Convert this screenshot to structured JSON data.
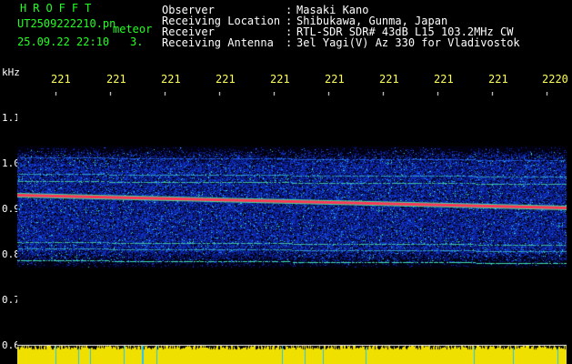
{
  "header": {
    "title": "HROFFT",
    "filename": "UT2509222210.pn",
    "mode": "meteor",
    "datetime": "25.09.22 22:10",
    "count": "3."
  },
  "info": [
    {
      "label": "Observer",
      "value": "Masaki Kano"
    },
    {
      "label": "Receiving Location",
      "value": "Shibukawa, Gunma, Japan"
    },
    {
      "label": "Receiver",
      "value": "RTL-SDR SDR# 43dB L15 103.2MHz CW"
    },
    {
      "label": "Receiving Antenna",
      "value": "3el Yagi(V) Az 330 for Vladivostok"
    }
  ],
  "axis": {
    "y_unit": "kHz",
    "y_ticks": [
      "1.1",
      "1.0",
      "0.9",
      "0.8",
      "0.7",
      "0.6"
    ],
    "x_ticks": [
      "221",
      "221",
      "221",
      "221",
      "221",
      "221",
      "221",
      "221",
      "221",
      "2220"
    ]
  },
  "colors": {
    "header_green": "#22ff22",
    "x_label_yellow": "#ffff55",
    "trace_red": "#ff3355",
    "noise_blue": "#1030c0",
    "bottom_band": "#f0e000"
  }
}
